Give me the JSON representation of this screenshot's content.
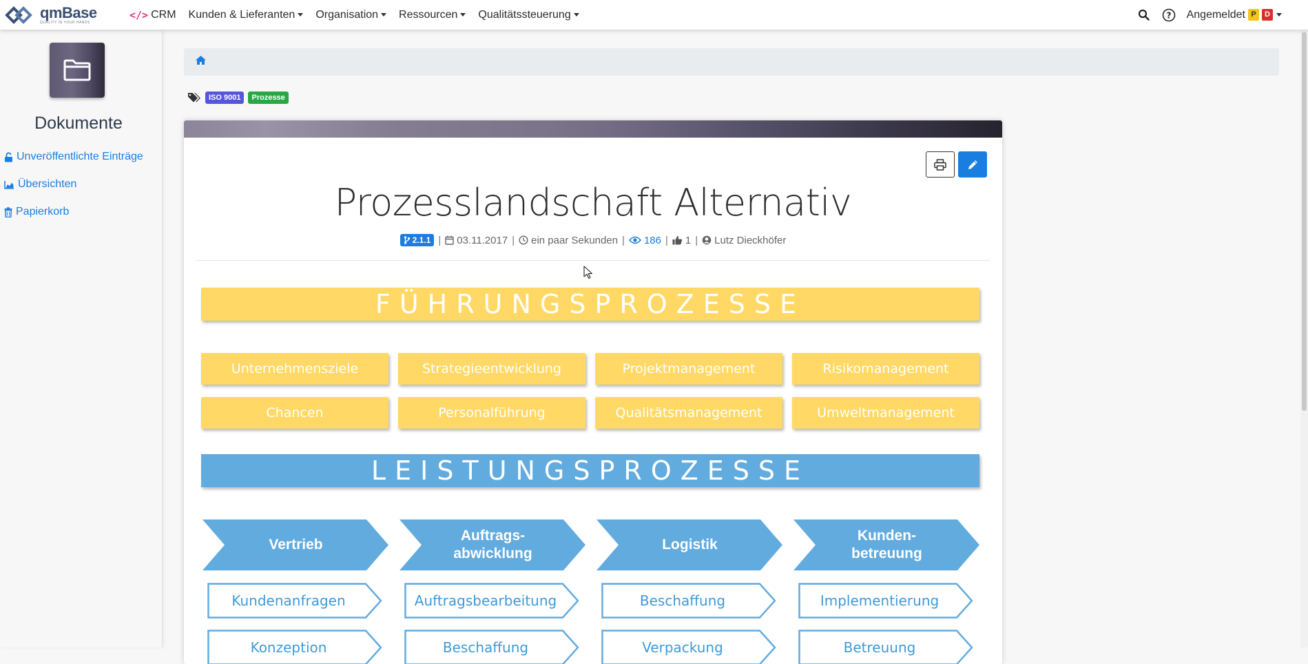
{
  "navbar": {
    "logo_name": "qmBase",
    "logo_tagline": "QUALITY IN YOUR HANDS",
    "menu": [
      {
        "label": "CRM",
        "has_caret": false
      },
      {
        "label": "Kunden & Lieferanten",
        "has_caret": true
      },
      {
        "label": "Organisation",
        "has_caret": true
      },
      {
        "label": "Ressourcen",
        "has_caret": true
      },
      {
        "label": "Qualitätssteuerung",
        "has_caret": true
      }
    ],
    "user_label": "Angemeldet",
    "user_badges": [
      "P",
      "D"
    ]
  },
  "sidebar": {
    "title": "Dokumente",
    "links": [
      {
        "label": "Unveröffentlichte Einträge",
        "icon": "unlock-icon"
      },
      {
        "label": "Übersichten",
        "icon": "area-chart-icon"
      },
      {
        "label": "Papierkorb",
        "icon": "trash-icon"
      }
    ]
  },
  "tags": [
    "ISO 9001",
    "Prozesse"
  ],
  "document": {
    "title": "Prozesslandschaft Alternativ",
    "version": "2.1.1",
    "date": "03.11.2017",
    "modified": "ein paar Sekunden",
    "views": "186",
    "likes": "1",
    "author": "Lutz Dieckhöfer"
  },
  "process_map": {
    "management_heading": "FÜHRUNGSPROZESSE",
    "management_items": [
      "Unternehmensziele",
      "Strategieentwicklung",
      "Projektmanagement",
      "Risikomanagement",
      "Chancen",
      "Personalführung",
      "Qualitätsmanagement",
      "Umweltmanagement"
    ],
    "core_heading": "LEISTUNGSPROZESSE",
    "core_chevrons": [
      "Vertrieb",
      "Auftrags-\nabwicklung",
      "Logistik",
      "Kunden-\nbetreuung"
    ],
    "core_sub_row1": [
      "Kundenanfragen",
      "Auftragsbearbeitung",
      "Beschaffung",
      "Implementierung"
    ],
    "core_sub_row2": [
      "Konzeption",
      "Beschaffung",
      "Verpackung",
      "Betreuung"
    ]
  },
  "colors": {
    "accent": "#1a7ee0",
    "management": "#ffd866",
    "core": "#62abdf",
    "crm_icon": "#e6337a"
  }
}
